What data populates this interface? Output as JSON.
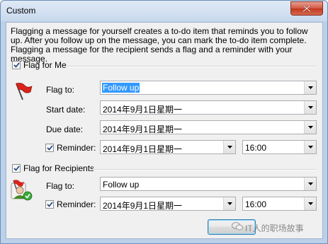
{
  "window": {
    "title": "Custom"
  },
  "description": "Flagging a message for yourself creates a to-do item that reminds you to follow up. After you follow up on the message, you can mark the to-do item complete. Flagging a message for the recipient sends a flag and a reminder with your message.",
  "flag_for_me": {
    "heading": "Flag for Me",
    "checked": true,
    "flag_to_label": "Flag to:",
    "flag_to_value": "Follow up",
    "start_date_label": "Start date:",
    "start_date_value": "2014年9月1日星期一",
    "due_date_label": "Due date:",
    "due_date_value": "2014年9月1日星期一",
    "reminder_label": "Reminder:",
    "reminder_checked": true,
    "reminder_date": "2014年9月1日星期一",
    "reminder_time": "16:00"
  },
  "flag_for_recipients": {
    "heading": "Flag for Recipients",
    "checked": true,
    "flag_to_label": "Flag to:",
    "flag_to_value": "Follow up",
    "reminder_label": "Reminder:",
    "reminder_checked": true,
    "reminder_date": "2014年9月1日星期一",
    "reminder_time": "16:00"
  },
  "buttons": {
    "ok": ""
  },
  "watermark": "IT人的职场故事",
  "colors": {
    "accent": "#3399ff",
    "flag_red": "#d8231b",
    "close_red": "#c1371f"
  }
}
